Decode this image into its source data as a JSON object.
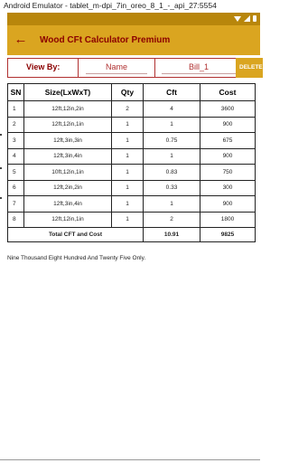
{
  "emulator": {
    "title": "Android Emulator - tablet_m-dpi_7in_oreo_8_1_-_api_27:5554"
  },
  "status_icons": [
    "wifi-icon",
    "signal-icon",
    "battery-icon"
  ],
  "app_bar": {
    "back_icon": "arrow-left-icon",
    "back_glyph": "←",
    "title": "Wood CFt Calculator Premium"
  },
  "controls": {
    "view_by_label": "View By:",
    "name_value": "Name",
    "bill_value": "Bill_1",
    "delete_label": "DELETE"
  },
  "table": {
    "headers": {
      "sn": "SN",
      "size": "Size(LxWxT)",
      "qty": "Qty",
      "cft": "Cft",
      "cost": "Cost"
    },
    "rows": [
      {
        "sn": "1",
        "size": "12ft,12in,2in",
        "qty": "2",
        "cft": "4",
        "cost": "3600"
      },
      {
        "sn": "2",
        "size": "12ft,12in,1in",
        "qty": "1",
        "cft": "1",
        "cost": "900"
      },
      {
        "sn": "3",
        "size": "12ft,3in,3in",
        "qty": "1",
        "cft": "0.75",
        "cost": "675"
      },
      {
        "sn": "4",
        "size": "12ft,3in,4in",
        "qty": "1",
        "cft": "1",
        "cost": "900"
      },
      {
        "sn": "5",
        "size": "10ft,12in,1in",
        "qty": "1",
        "cft": "0.83",
        "cost": "750"
      },
      {
        "sn": "6",
        "size": "12ft,2in,2in",
        "qty": "1",
        "cft": "0.33",
        "cost": "300"
      },
      {
        "sn": "7",
        "size": "12ft,3in,4in",
        "qty": "1",
        "cft": "1",
        "cost": "900"
      },
      {
        "sn": "8",
        "size": "12ft,12in,1in",
        "qty": "1",
        "cft": "2",
        "cost": "1800"
      }
    ],
    "total": {
      "label": "Total CFT and Cost",
      "cft": "10.91",
      "cost": "9825"
    }
  },
  "amount_in_words": "Nine Thousand  Eight Hundred And Twenty Five Only.",
  "colors": {
    "accent": "#daa520",
    "status_bar": "#b8860b",
    "title_text": "#8b0000",
    "border": "#b03030"
  }
}
